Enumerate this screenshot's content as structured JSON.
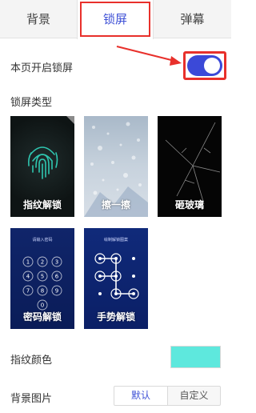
{
  "tabs": [
    {
      "label": "背景",
      "active": false
    },
    {
      "label": "锁屏",
      "active": true
    },
    {
      "label": "弹幕",
      "active": false
    }
  ],
  "lock_toggle": {
    "label": "本页开启锁屏",
    "enabled": true
  },
  "lock_types": {
    "section_label": "锁屏类型",
    "items": [
      {
        "caption": "指纹解锁",
        "icon": "fingerprint-icon"
      },
      {
        "caption": "擦一擦",
        "icon": "rain-glass"
      },
      {
        "caption": "砸玻璃",
        "icon": "cracked-glass"
      },
      {
        "caption": "密码解锁",
        "icon": "pin-keypad",
        "prompt": "请输入密码",
        "keys": [
          "1",
          "2",
          "3",
          "4",
          "5",
          "6",
          "7",
          "8",
          "9",
          "0"
        ]
      },
      {
        "caption": "手势解锁",
        "icon": "pattern-grid",
        "prompt": "绘制解锁图案"
      }
    ]
  },
  "fingerprint_color": {
    "label": "指纹颜色",
    "value": "#5ee8dd"
  },
  "background_image": {
    "label": "背景图片",
    "options": [
      {
        "label": "默认",
        "selected": true
      },
      {
        "label": "自定义",
        "selected": false
      }
    ]
  },
  "annotation_color": "#e8302b",
  "accent_color": "#3b49d8"
}
